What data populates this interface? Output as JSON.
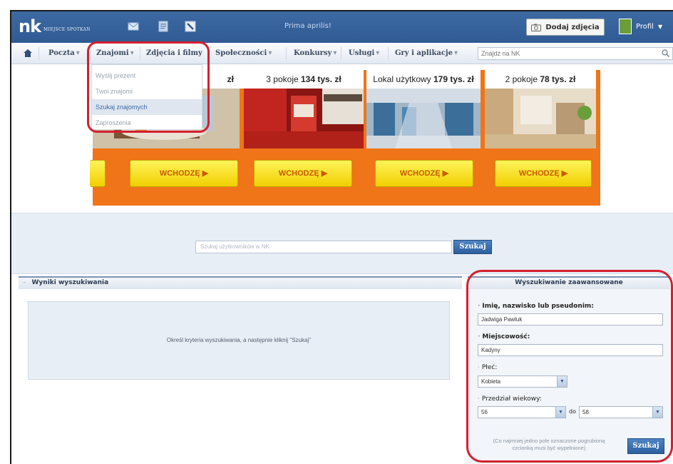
{
  "topbar": {
    "logo": "nk",
    "logo_tagline": "MIEJSCE SPOTKAŃ",
    "announcement": "Prima aprilis!",
    "add_photos_label": "Dodaj zdjęcia",
    "profile_label": "Profil"
  },
  "nav": {
    "items": [
      {
        "label": "Poczta"
      },
      {
        "label": "Znajomi"
      },
      {
        "label": "Zdjęcia i filmy"
      },
      {
        "label": "Społeczności"
      },
      {
        "label": "Konkursy"
      },
      {
        "label": "Usługi"
      },
      {
        "label": "Gry i aplikacje"
      }
    ],
    "arrow": "▾",
    "search_placeholder": "Znajdź na NK"
  },
  "dropdown": {
    "items": [
      {
        "label": "Wyślij prezent",
        "active": false
      },
      {
        "label": "Twoi znajomi",
        "active": false
      },
      {
        "label": "Szukaj znajomych",
        "active": true
      },
      {
        "label": "Zaproszenia",
        "active": false
      }
    ]
  },
  "banner": {
    "panels": [
      {
        "title_prefix": "",
        "title_bold": "zł",
        "button": "WCHODZĘ ▶"
      },
      {
        "title_prefix": "3 pokoje ",
        "title_bold": "134 tys. zł",
        "button": "WCHODZĘ ▶"
      },
      {
        "title_prefix": "Lokal użytkowy ",
        "title_bold": "179 tys. zł",
        "button": "WCHODZĘ ▶"
      },
      {
        "title_prefix": "2 pokoje ",
        "title_bold": "78 tys. zł",
        "button": "WCHODZĘ ▶"
      }
    ]
  },
  "user_search": {
    "placeholder": "Szukaj użytkowników w NK",
    "button": "Szukaj"
  },
  "results": {
    "title": "Wyniki wyszukiwania",
    "collapse_symbol": "–",
    "hint": "Określ kryteria wyszukiwania, a następnie kliknij \"Szukaj\""
  },
  "advanced": {
    "title": "Wyszukiwanie zaawansowane",
    "name_label": "Imię, nazwisko lub pseudonim:",
    "name_value": "Jadwiga Pawluk",
    "city_label": "Miejscowość:",
    "city_value": "Kadyny",
    "gender_label": "Płeć:",
    "gender_value": "Kobieta",
    "age_label": "Przedział wiekowy:",
    "age_from": "56",
    "age_sep": "do",
    "age_to": "58",
    "note": "(Co najmniej jedno pole oznaczone pogrubioną czcionką musi być wypełnione)",
    "button": "Szukaj"
  },
  "colors": {
    "brand_blue": "#2f5a93",
    "highlight_red": "#d3202f",
    "banner_orange": "#f07418"
  }
}
